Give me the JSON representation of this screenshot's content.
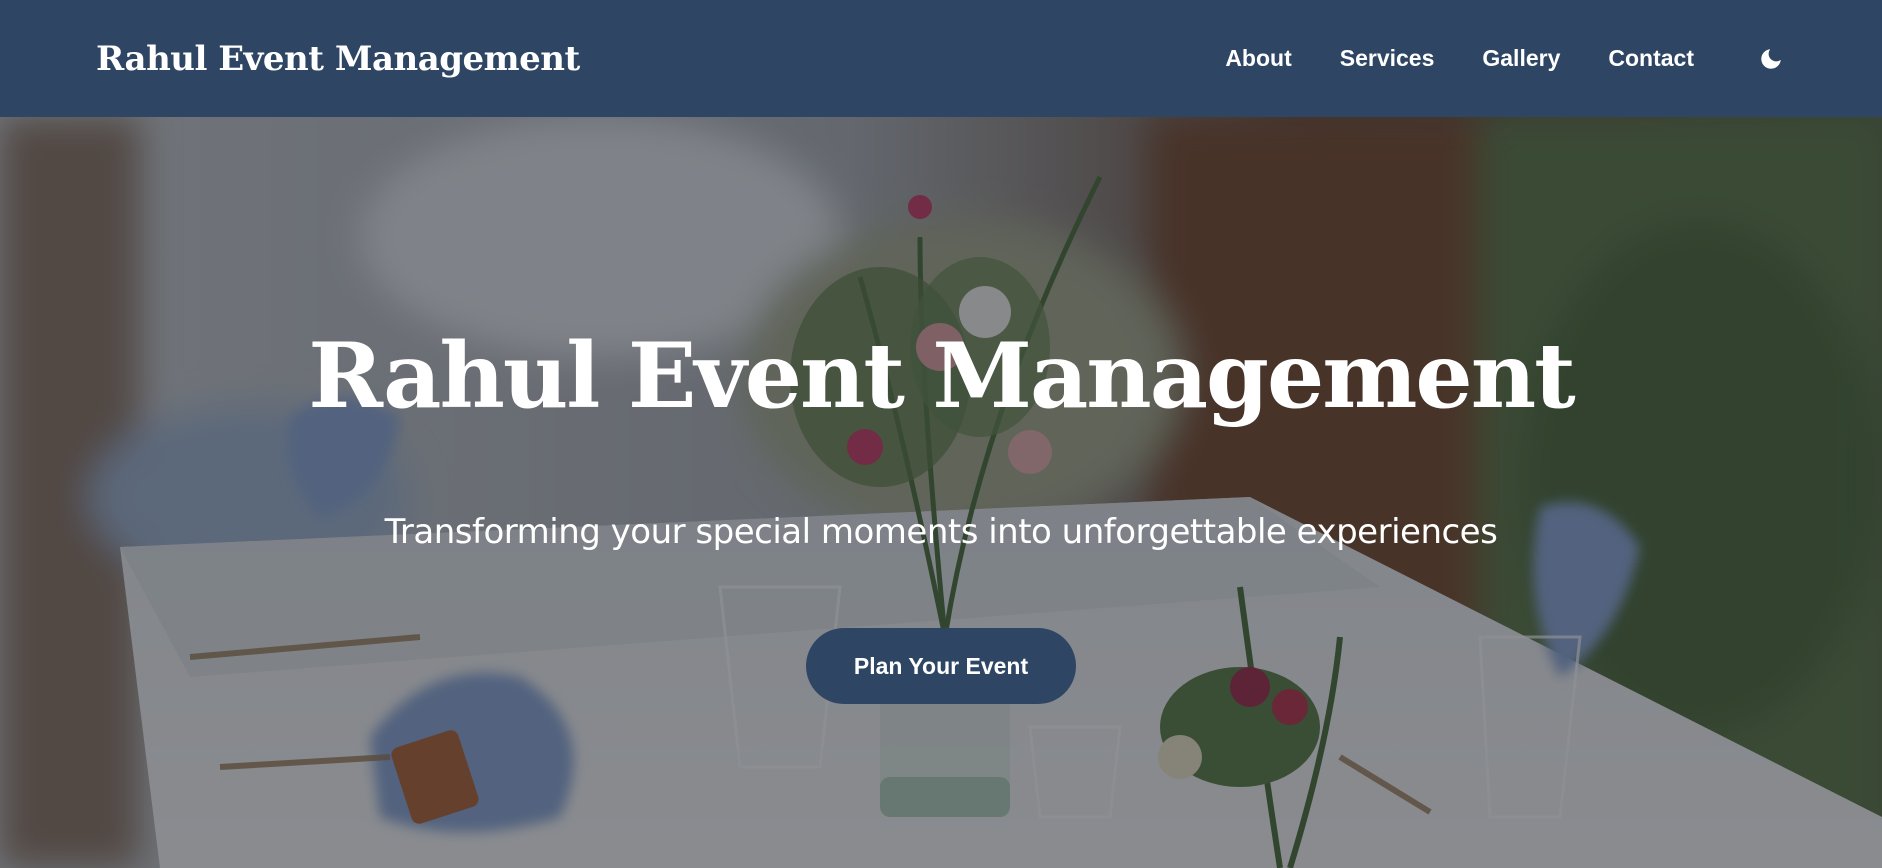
{
  "header": {
    "brand": "Rahul Event Management",
    "nav_items": [
      {
        "label": "About"
      },
      {
        "label": "Services"
      },
      {
        "label": "Gallery"
      },
      {
        "label": "Contact"
      }
    ],
    "theme_toggle_icon": "moon-icon"
  },
  "hero": {
    "title": "Rahul Event Management",
    "subtitle": "Transforming your special moments into unforgettable experiences",
    "cta_label": "Plan Your Event",
    "background_image": "banquet-table-photo"
  },
  "colors": {
    "nav_background": "#2e4663",
    "button_background": "#2e4663",
    "text": "#ffffff"
  }
}
